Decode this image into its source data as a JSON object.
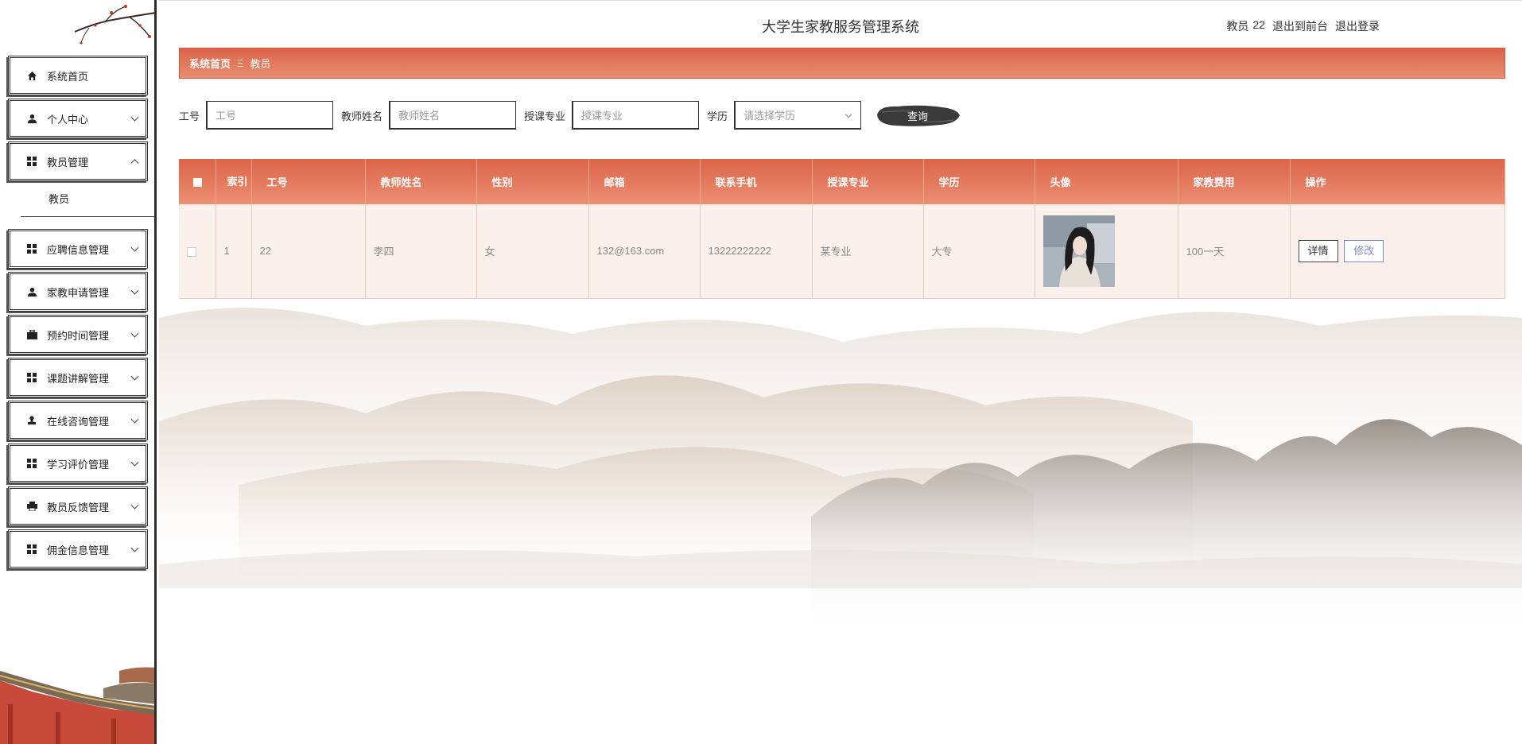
{
  "header": {
    "title": "大学生家教服务管理系统",
    "user_role": "教员",
    "user_name": "22",
    "front_link": "退出到前台",
    "logout_link": "退出登录"
  },
  "sidebar": {
    "items": [
      {
        "label": "系统首页",
        "icon": "home-icon"
      },
      {
        "label": "个人中心",
        "icon": "user-icon"
      },
      {
        "label": "教员管理",
        "icon": "grid-icon",
        "expanded": true,
        "sub": [
          "教员"
        ]
      },
      {
        "label": "应聘信息管理",
        "icon": "grid-icon"
      },
      {
        "label": "家教申请管理",
        "icon": "user-icon"
      },
      {
        "label": "预约时间管理",
        "icon": "briefcase-icon"
      },
      {
        "label": "课题讲解管理",
        "icon": "grid-icon"
      },
      {
        "label": "在线咨询管理",
        "icon": "stamp-icon"
      },
      {
        "label": "学习评价管理",
        "icon": "grid-icon"
      },
      {
        "label": "教员反馈管理",
        "icon": "printer-icon"
      },
      {
        "label": "佣金信息管理",
        "icon": "grid-icon"
      }
    ]
  },
  "breadcrumb": {
    "home": "系统首页",
    "separator": "Ξ",
    "current": "教员"
  },
  "search": {
    "fields": [
      {
        "label": "工号",
        "placeholder": "工号"
      },
      {
        "label": "教师姓名",
        "placeholder": "教师姓名"
      },
      {
        "label": "授课专业",
        "placeholder": "授课专业"
      },
      {
        "label": "学历",
        "placeholder": "请选择学历"
      }
    ],
    "button": "查询"
  },
  "table": {
    "columns": [
      "索引",
      "工号",
      "教师姓名",
      "性别",
      "邮箱",
      "联系手机",
      "授课专业",
      "学历",
      "头像",
      "家教费用",
      "操作"
    ],
    "rows": [
      {
        "index": "1",
        "job_no": "22",
        "name": "李四",
        "gender": "女",
        "email": "132@163.com",
        "phone": "13222222222",
        "major": "某专业",
        "education": "大专",
        "fee": "100一天"
      }
    ],
    "actions": {
      "detail": "详情",
      "edit": "修改"
    }
  },
  "colors": {
    "accent": "#dc6448",
    "row_bg": "#fcf0ec",
    "edit_btn": "#7a8bd6"
  }
}
